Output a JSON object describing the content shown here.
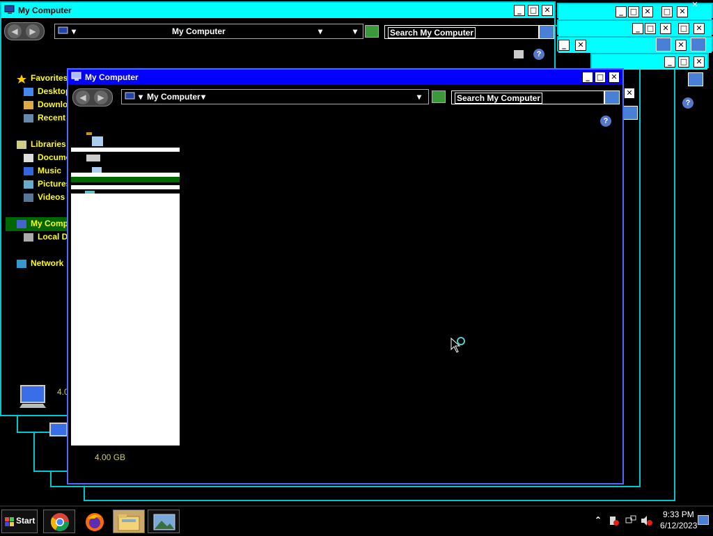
{
  "app": {
    "window_title": "My Computer",
    "address": "My Computer",
    "search_placeholder": "Search My Computer"
  },
  "nav": {
    "favorites": "Favorites",
    "desktop": "Desktop",
    "downloads": "Downloads",
    "recent": "Recent",
    "libraries": "Libraries",
    "documents": "Documents",
    "music": "Music",
    "pictures": "Pictures",
    "videos": "Videos",
    "my_computer": "My Comp",
    "local_disk": "Local D",
    "network": "Network"
  },
  "status": {
    "back_size": "4.0",
    "front_size": "4.00 GB"
  },
  "taskbar": {
    "start": "Start",
    "time": "9:33 PM",
    "date": "6/12/2023"
  },
  "controls": {
    "min": "_",
    "max": "□",
    "close": "✕",
    "help": "?",
    "back": "◀",
    "forward": "▶",
    "arrow": "▾",
    "expand": "⌃"
  },
  "colors": {
    "titlebar_inactive": "#00ffff",
    "titlebar_active": "#0000ff",
    "nav_text": "#ffff00",
    "selection": "#006600"
  }
}
